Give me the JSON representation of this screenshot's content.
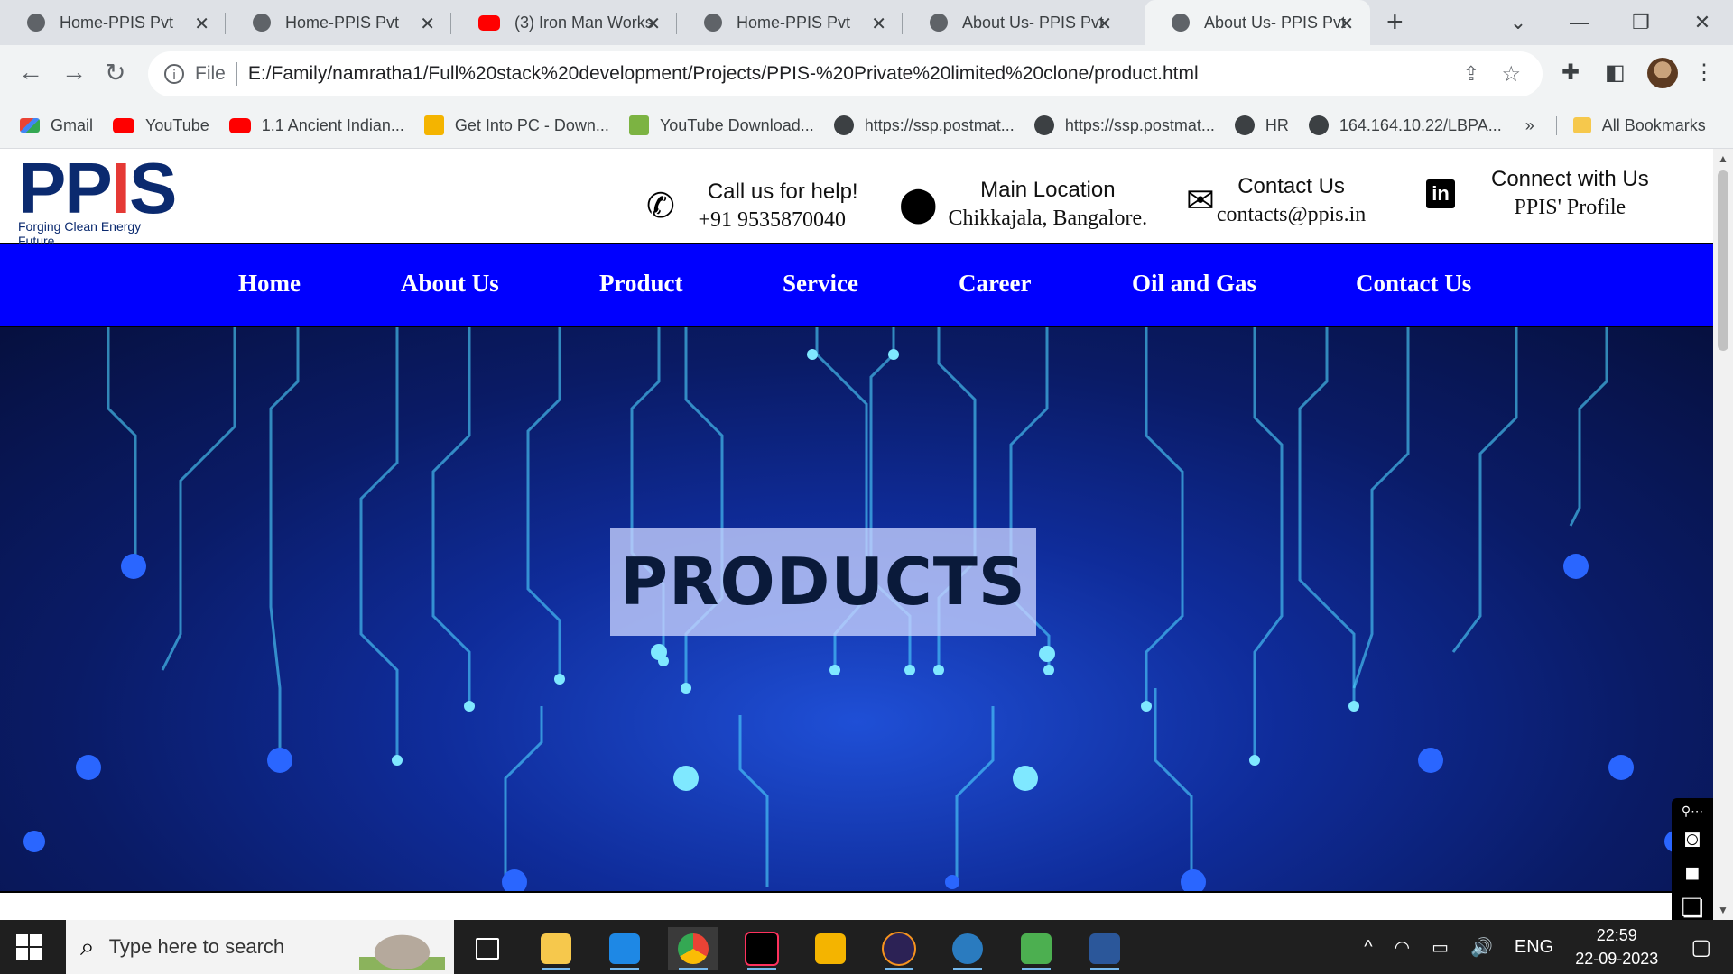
{
  "browser": {
    "tabs": [
      {
        "title": "Home-PPIS Pvt",
        "favicon": "globe-icon",
        "active": false
      },
      {
        "title": "Home-PPIS Pvt",
        "favicon": "globe-icon",
        "active": false
      },
      {
        "title": "(3) Iron Man Works",
        "favicon": "youtube-icon",
        "active": false
      },
      {
        "title": "Home-PPIS Pvt",
        "favicon": "globe-icon",
        "active": false
      },
      {
        "title": "About Us- PPIS Pvt",
        "favicon": "globe-icon",
        "active": false
      },
      {
        "title": "About Us- PPIS Pvt",
        "favicon": "globe-icon",
        "active": true
      }
    ],
    "address": {
      "scheme_label": "File",
      "url": "E:/Family/namratha1/Full%20stack%20development/Projects/PPIS-%20Private%20limited%20clone/product.html"
    },
    "bookmarks": [
      {
        "label": "Gmail",
        "icon": "gmail-icon"
      },
      {
        "label": "YouTube",
        "icon": "youtube-icon"
      },
      {
        "label": "1.1 Ancient Indian...",
        "icon": "youtube-icon"
      },
      {
        "label": "Get Into PC - Down...",
        "icon": "getintopc-icon"
      },
      {
        "label": "YouTube Download...",
        "icon": "download-icon"
      },
      {
        "label": "https://ssp.postmat...",
        "icon": "globe-icon"
      },
      {
        "label": "https://ssp.postmat...",
        "icon": "globe-icon"
      },
      {
        "label": "HR",
        "icon": "globe-icon"
      },
      {
        "label": "164.164.10.22/LBPA...",
        "icon": "globe-icon"
      }
    ],
    "bookmarks_overflow": "»",
    "all_bookmarks": "All Bookmarks"
  },
  "site": {
    "logo": {
      "text": "PPIS",
      "tagline": "Forging Clean Energy Future"
    },
    "contacts": [
      {
        "icon": "phone-icon",
        "line1": "Call us for help!",
        "line2": "+91 9535870040"
      },
      {
        "icon": "location-pin-icon",
        "line1": "Main Location",
        "line2": "Chikkajala, Bangalore."
      },
      {
        "icon": "envelope-icon",
        "line1": "Contact Us",
        "line2": "contacts@ppis.in"
      },
      {
        "icon": "linkedin-icon",
        "line1": "Connect with Us",
        "line2": "PPIS' Profile"
      }
    ],
    "nav": [
      "Home",
      "About Us",
      "Product",
      "Service",
      "Career",
      "Oil and Gas",
      "Contact Us"
    ],
    "hero_title": "PRODUCTS",
    "nav_color": "#0000ff"
  },
  "taskbar": {
    "search_placeholder": "Type here to search",
    "language": "ENG",
    "time": "22:59",
    "date": "22-09-2023"
  }
}
